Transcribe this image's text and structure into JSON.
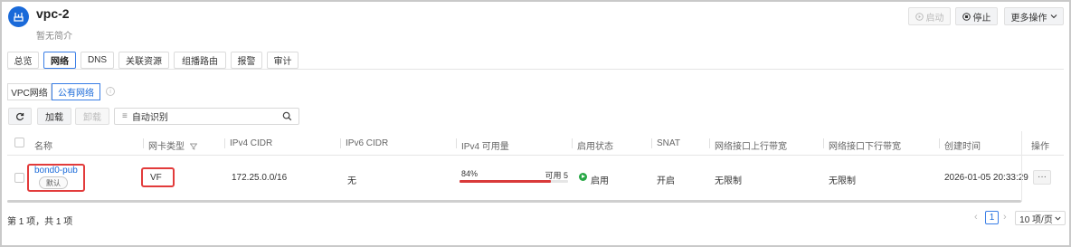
{
  "header": {
    "title": "vpc-2",
    "subtitle": "暂无简介",
    "start_label": "启动",
    "stop_label": "停止",
    "more_label": "更多操作"
  },
  "tabs": [
    {
      "label": "总览"
    },
    {
      "label": "网络"
    },
    {
      "label": "DNS"
    },
    {
      "label": "关联资源"
    },
    {
      "label": "组播路由"
    },
    {
      "label": "报警"
    },
    {
      "label": "审计"
    }
  ],
  "subtabs": [
    {
      "label": "VPC网络"
    },
    {
      "label": "公有网络"
    }
  ],
  "toolbar": {
    "load_label": "加载",
    "unload_label": "卸载",
    "filter_value": "自动识别"
  },
  "table": {
    "columns": [
      "名称",
      "网卡类型",
      "IPv4 CIDR",
      "IPv6 CIDR",
      "IPv4 可用量",
      "启用状态",
      "SNAT",
      "网络接口上行带宽",
      "网络接口下行带宽",
      "创建时间",
      "操作"
    ],
    "rows": [
      {
        "name": "bond0-pub",
        "badge": "默认",
        "nic_type": "VF",
        "ipv4_cidr": "172.25.0.0/16",
        "ipv6_cidr": "无",
        "ipv4_usage_percent": "84%",
        "ipv4_usage_fraction": 0.84,
        "ipv4_available": "可用 5",
        "status": "启用",
        "snat": "开启",
        "up_bandwidth": "无限制",
        "down_bandwidth": "无限制",
        "created": "2026-01-05 20:33:29",
        "action": "···"
      }
    ]
  },
  "footer": {
    "summary": "第 1 项，共 1 项",
    "page": "1",
    "page_size": "10 项/页"
  },
  "colors": {
    "accent": "#1a6ad9",
    "highlight": "#e23b3b",
    "enabled": "#27a745"
  }
}
